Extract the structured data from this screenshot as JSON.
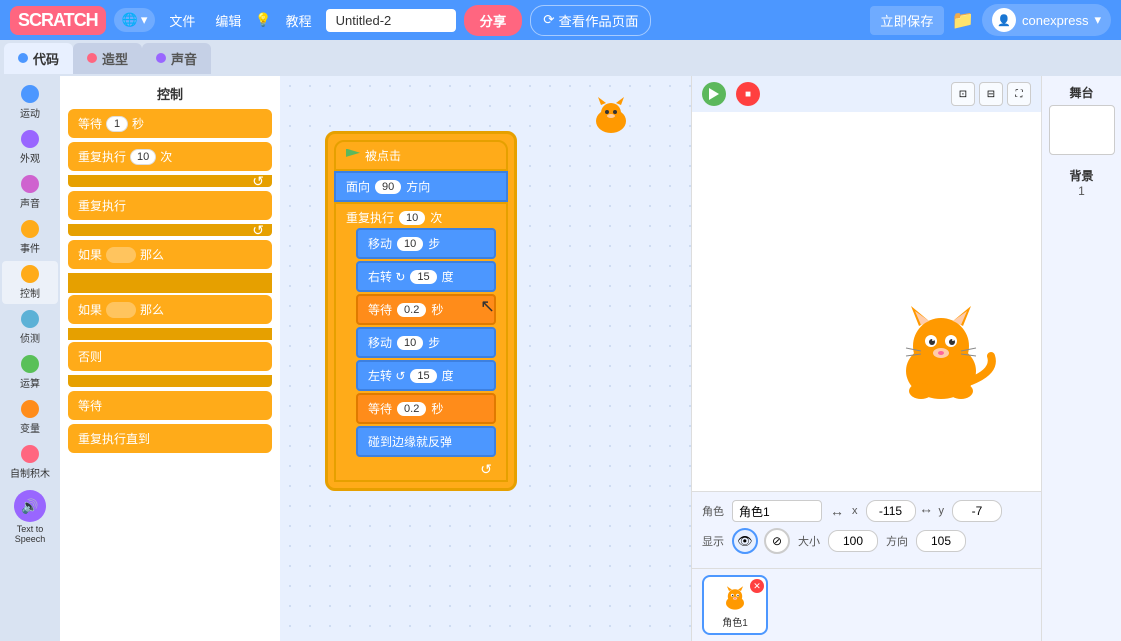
{
  "topnav": {
    "logo": "SCRATCH",
    "globe_label": "🌐",
    "menu_file": "文件",
    "menu_edit": "编辑",
    "tutorial_icon": "💡",
    "tutorial_label": "教程",
    "project_name": "Untitled-2",
    "share_btn": "分享",
    "view_page_icon": "⟳",
    "view_page_label": "查看作品页面",
    "save_btn": "立即保存",
    "folder_icon": "📁",
    "user_name": "conexpress",
    "user_arrow": "▾"
  },
  "tabs": [
    {
      "label": "代码",
      "color": "#4c97ff",
      "active": true
    },
    {
      "label": "造型",
      "color": "#ff6680",
      "active": false
    },
    {
      "label": "声音",
      "color": "#9966ff",
      "active": false
    }
  ],
  "categories": [
    {
      "label": "运动",
      "color": "#4c97ff"
    },
    {
      "label": "外观",
      "color": "#9966ff"
    },
    {
      "label": "声音",
      "color": "#cf63cf"
    },
    {
      "label": "事件",
      "color": "#ffab19"
    },
    {
      "label": "控制",
      "color": "#ffab19"
    },
    {
      "label": "侦测",
      "color": "#5cb1d6"
    },
    {
      "label": "运算",
      "color": "#59c059"
    },
    {
      "label": "变量",
      "color": "#ff8c1a"
    },
    {
      "label": "自制积木",
      "color": "#ff6680"
    },
    {
      "label": "Text to Speech",
      "color": "#9966ff"
    }
  ],
  "blocks_panel": {
    "title": "控制",
    "blocks": [
      {
        "text": "等待",
        "param": "1",
        "suffix": "秒"
      },
      {
        "text": "重复执行",
        "param": "10",
        "suffix": "次"
      },
      {
        "text": "重复执行"
      },
      {
        "text": "如果",
        "param": "那么"
      },
      {
        "text": "如果",
        "param": "那么"
      },
      {
        "text": "否则"
      },
      {
        "text": "等待"
      },
      {
        "text": "重复执行直到"
      }
    ]
  },
  "code_blocks": [
    {
      "type": "event",
      "text": "当 🚩 被点击"
    },
    {
      "type": "motion",
      "text": "面向",
      "param": "90",
      "suffix": "方向"
    },
    {
      "type": "control",
      "text": "重复执行",
      "param": "10",
      "suffix": "次"
    },
    {
      "type": "motion",
      "text": "移动",
      "param": "10",
      "suffix": "步"
    },
    {
      "type": "motion",
      "text": "右转 ↻",
      "param": "15",
      "suffix": "度"
    },
    {
      "type": "control",
      "text": "等待",
      "param": "0.2",
      "suffix": "秒"
    },
    {
      "type": "motion",
      "text": "移动",
      "param": "10",
      "suffix": "步"
    },
    {
      "type": "motion",
      "text": "左转 ↺",
      "param": "15",
      "suffix": "度"
    },
    {
      "type": "control",
      "text": "等待",
      "param": "0.2",
      "suffix": "秒"
    },
    {
      "type": "motion",
      "text": "碰到边缘就反弹"
    }
  ],
  "stage": {
    "flag_title": "运行",
    "stop_title": "停止",
    "sprite_label": "角色",
    "sprite_name": "角色1",
    "x_label": "x",
    "x_value": "-115",
    "y_label": "y",
    "y_value": "-7",
    "show_label": "显示",
    "size_label": "大小",
    "size_value": "100",
    "direction_label": "方向",
    "direction_value": "105",
    "sprite_thumb_label": "角色1",
    "backdrop_label": "背景",
    "backdrop_count": "1"
  }
}
